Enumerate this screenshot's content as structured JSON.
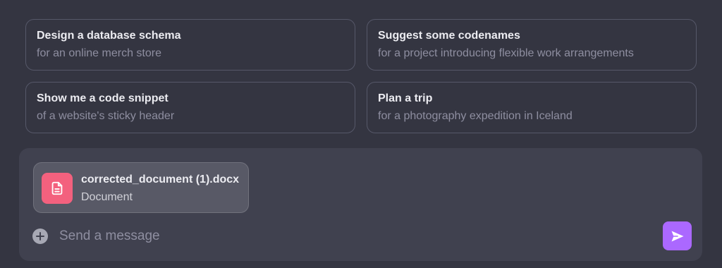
{
  "suggestions": [
    {
      "title": "Design a database schema",
      "subtitle": "for an online merch store"
    },
    {
      "title": "Suggest some codenames",
      "subtitle": "for a project introducing flexible work arrangements"
    },
    {
      "title": "Show me a code snippet",
      "subtitle": "of a website's sticky header"
    },
    {
      "title": "Plan a trip",
      "subtitle": "for a photography expedition in Iceland"
    }
  ],
  "composer": {
    "attachment": {
      "file_name": "corrected_document (1).docx",
      "file_type": "Document",
      "icon": "document-icon",
      "icon_color": "#f3617e"
    },
    "placeholder": "Send a message",
    "value": "",
    "add_icon": "plus-circle-icon",
    "send_icon": "send-icon",
    "send_color": "#ab68ff"
  }
}
